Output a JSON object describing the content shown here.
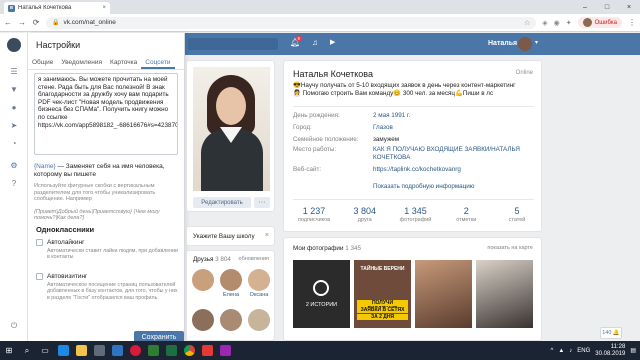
{
  "browser": {
    "tab_title": "Наталья Кочеткова",
    "tab_close": "×",
    "url": "vk.com/nat_online",
    "error_label": "Ошибка",
    "window_controls": [
      "–",
      "□",
      "×"
    ],
    "nav": {
      "back": "←",
      "forward": "→",
      "reload": "⟳"
    }
  },
  "vk_header": {
    "user_name": "Наталья",
    "notifications_badge": "9"
  },
  "settings": {
    "title": "Настройки",
    "tabs": [
      {
        "label": "Общие",
        "active": false
      },
      {
        "label": "Уведомления",
        "active": false
      },
      {
        "label": "Карточка",
        "active": false
      },
      {
        "label": "Соцсети",
        "active": true
      }
    ],
    "message_text": "я занимаюсь. Вы можете прочитать на моей стене. Рада быть для Вас полезной! В знак благодарности за дружбу хочу вам подарить PDF чек-лист \"Новая модель продвижения бизнеса без СПАМа\". Получить книгу можно по ссылке https://vk.com/app5898182_-68616676#s=423870",
    "name_help_tag": "{Name}",
    "name_help_text": " — Заменяет себя на имя человека, которому вы пишете",
    "gray_help": "Используйте фигурные скобки с вертикальным разделителем для того чтобы уникализировать сообщение. Например",
    "example": "{Привет|Добрый день|Приветствую} {Чем могу помочь?|Как дела?}",
    "section_title": "Одноклассники",
    "options": [
      {
        "label": "Автолайкинг",
        "desc": "Автоматически ставит лайки людям, при добавлении в контакты"
      },
      {
        "label": "Автовизитинг",
        "desc": "Автоматическое посещение страниц пользователей добавленных в базу контактов, для того, чтобы у них в разделе \"Гости\" отобразился ваш профиль"
      }
    ],
    "save_label": "Сохранить"
  },
  "profile": {
    "name": "Наталья Кочеткова",
    "online": "Online",
    "status": "😎Научу получать от 5-10 входящих заявок в день через контент-маркетинг👩‍💼 Помогаю строить Вам команду😊 300 чел. за месяц💪Пиши в лс",
    "info": [
      {
        "key": "День рождения:",
        "value": "2 мая 1991 г.",
        "link": true
      },
      {
        "key": "Город:",
        "value": "Глазов",
        "link": true
      },
      {
        "key": "Семейное положение:",
        "value": "замужем",
        "link": false
      },
      {
        "key": "Место работы:",
        "value": "КАК Я ПОЛУЧАЮ ВХОДЯЩИЕ ЗАЯВКИ/НАТАЛЬЯ КОЧЕТКОВА",
        "link": true
      },
      {
        "key": "Веб-сайт:",
        "value": "https://taplink.cc/kochetkovanrg",
        "link": true
      }
    ],
    "more_info": "Показать подробную информацию",
    "edit_label": "Редактировать",
    "more_label": "···",
    "counters": [
      {
        "num": "1 237",
        "label": "подписчиков"
      },
      {
        "num": "3 804",
        "label": "друга"
      },
      {
        "num": "1 345",
        "label": "фотографий"
      },
      {
        "num": "2",
        "label": "отметки"
      },
      {
        "num": "5",
        "label": "статей"
      }
    ]
  },
  "school": {
    "title": "Укажите Вашу школу",
    "close": "×"
  },
  "friends": {
    "title": "Друзья",
    "count": "3 804",
    "link": "обновления",
    "items": [
      {
        "name": "",
        "color": "#c9a07c"
      },
      {
        "name": "Елена",
        "color": "#b38b6d"
      },
      {
        "name": "Оксана",
        "color": "#d4b190"
      },
      {
        "name": "",
        "color": "#8c6f5a"
      },
      {
        "name": "",
        "color": "#a98a73"
      },
      {
        "name": "",
        "color": "#c7b49a"
      }
    ]
  },
  "photos": {
    "title": "Мои фотографии",
    "count": "1 345",
    "link": "показать на карте",
    "stories_label": "2 ИСТОРИИ",
    "promo_lines": [
      "ТАЙНЫЕ ВЕРЕНИ",
      "ПОЛУЧИ ВХОДЯЩИЕ",
      "ЗАЯВКИ В СЕТЯХ",
      "ЗА 2 ДНЯ"
    ]
  },
  "side_mini": "140 🔔",
  "taskbar": {
    "lang": "ENG",
    "time": "11:28",
    "date": "30.08.2019"
  },
  "colors": {
    "vk_blue": "#4a76a8",
    "link": "#2a5885",
    "taskbar": "#1b2433"
  }
}
